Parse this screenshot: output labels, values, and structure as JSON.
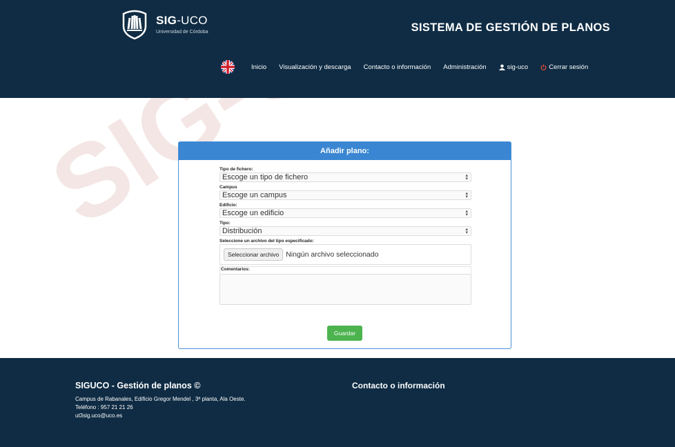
{
  "header": {
    "brand_bold": "SIG",
    "brand_light": "-UCO",
    "brand_subtitle": "Universidad de Córdoba",
    "system_title": "SISTEMA DE GESTIÓN DE PLANOS"
  },
  "nav": {
    "items": [
      {
        "label": "Inicio"
      },
      {
        "label": "Visualización y descarga"
      },
      {
        "label": "Contacto o información"
      },
      {
        "label": "Administración"
      },
      {
        "label": "sig-uco",
        "icon": "user-icon"
      },
      {
        "label": "Cerrar sesión",
        "icon": "power-icon"
      }
    ],
    "language_icon": "uk-flag-icon"
  },
  "form": {
    "heading": "Añadir plano:",
    "file_type_label": "Tipo de fichero:",
    "file_type_value": "Escoge un tipo de fichero",
    "campus_label": "Campus",
    "campus_value": "Escoge un campus",
    "building_label": "Edificio:",
    "building_value": "Escoge un edificio",
    "type_label": "Tipo:",
    "type_value": "Distribución",
    "file_label": "Seleccione un archivo del tipo especificado:",
    "file_button": "Seleccionar archivo",
    "file_status": "Ningún archivo seleccionado",
    "comments_label": "Comentarios:",
    "save_label": "Guardar"
  },
  "footer": {
    "title": "SIGUCO - Gestión de planos ©",
    "address": "Campus de Rabanales, Edificio Gregor Mendel , 3ª planta, Ala Oeste.",
    "phone": "Teléfono : 957 21 21 26",
    "email": "ut3sig.uco@uco.es",
    "contact_title": "Contacto o información"
  },
  "watermark_text": "SIG-Universidad de Córdoba",
  "colors": {
    "header_bg": "#0f2c44",
    "panel_heading": "#3a86d2",
    "save_button": "#4cb34f",
    "logout_icon": "#e74c3c"
  }
}
